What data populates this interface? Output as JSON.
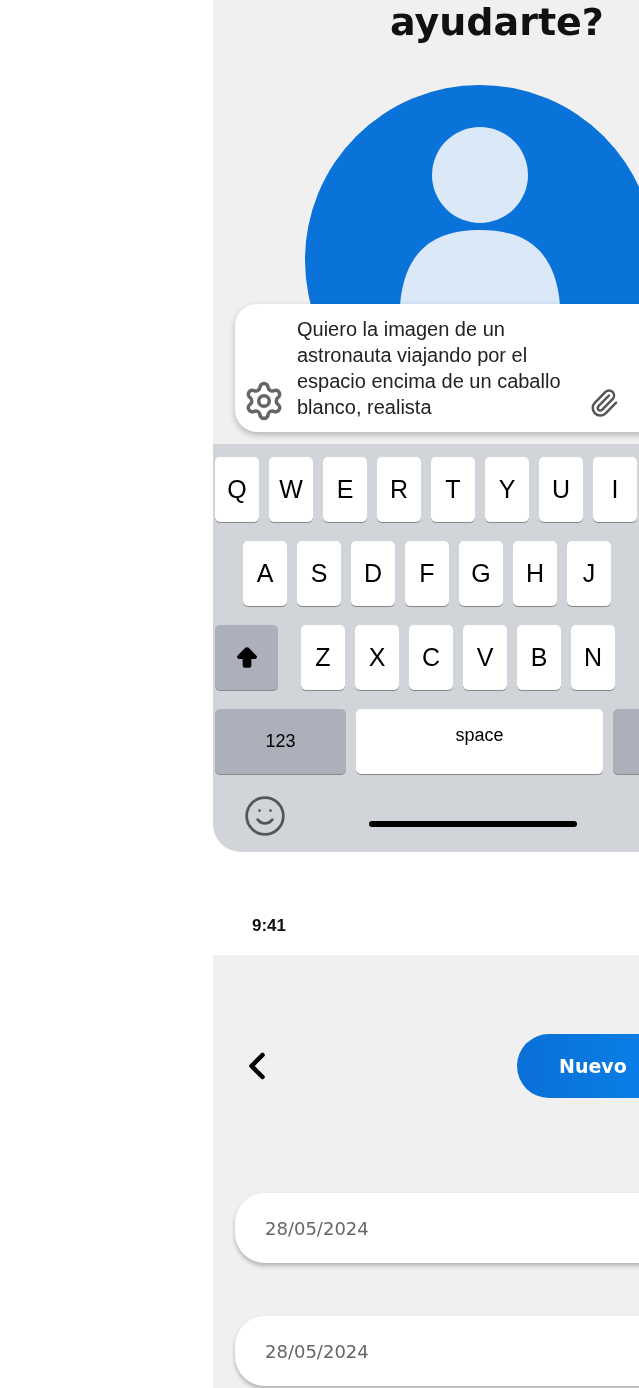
{
  "top_screen": {
    "heading": "ayudarte?",
    "prompt": {
      "value": "Quiero la imagen de un astronauta viajando por el espacio encima de un caballo blanco, realista"
    },
    "keyboard": {
      "rows": [
        [
          "Q",
          "W",
          "E",
          "R",
          "T",
          "Y",
          "U",
          "I"
        ],
        [
          "A",
          "S",
          "D",
          "F",
          "G",
          "H",
          "J"
        ],
        [
          "Z",
          "X",
          "C",
          "V",
          "B",
          "N"
        ]
      ],
      "number_key": "123",
      "space_key": "space"
    }
  },
  "bottom_screen": {
    "status_bar": {
      "time": "9:41"
    },
    "new_button": "Nuevo",
    "date_fields": [
      {
        "value": "28/05/2024"
      },
      {
        "value": "28/05/2024"
      }
    ]
  }
}
